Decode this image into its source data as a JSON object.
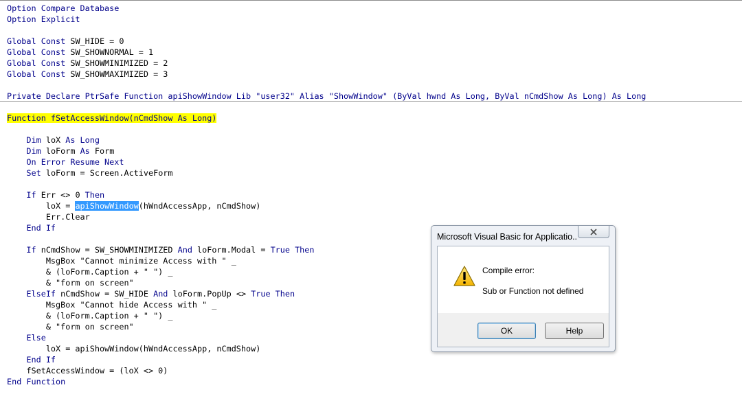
{
  "code": {
    "lines": [
      [
        {
          "t": "Option Compare Database",
          "c": "kw"
        }
      ],
      [
        {
          "t": "Option Explicit",
          "c": "kw"
        }
      ],
      [],
      [
        {
          "t": "Global Const",
          "c": "kw"
        },
        {
          "t": " SW_HIDE = 0"
        }
      ],
      [
        {
          "t": "Global Const",
          "c": "kw"
        },
        {
          "t": " SW_SHOWNORMAL = 1"
        }
      ],
      [
        {
          "t": "Global Const",
          "c": "kw"
        },
        {
          "t": " SW_SHOWMINIMIZED = 2"
        }
      ],
      [
        {
          "t": "Global Const",
          "c": "kw"
        },
        {
          "t": " SW_SHOWMAXIMIZED = 3"
        }
      ],
      [],
      [
        {
          "t": "Private Declare PtrSafe Function apiShowWindow Lib \"user32\" Alias \"ShowWindow\" (ByVal hwnd As Long, ByVal nCmdShow As Long) As Long",
          "c": "kw"
        }
      ],
      [],
      [
        {
          "t": "Function fSetAccessWindow(nCmdShow As Long)",
          "c": "kw hl-yellow"
        }
      ],
      [],
      [
        {
          "t": "    "
        },
        {
          "t": "Dim",
          "c": "kw"
        },
        {
          "t": " loX "
        },
        {
          "t": "As Long",
          "c": "kw"
        }
      ],
      [
        {
          "t": "    "
        },
        {
          "t": "Dim",
          "c": "kw"
        },
        {
          "t": " loForm "
        },
        {
          "t": "As",
          "c": "kw"
        },
        {
          "t": " Form"
        }
      ],
      [
        {
          "t": "    "
        },
        {
          "t": "On Error Resume Next",
          "c": "kw"
        }
      ],
      [
        {
          "t": "    "
        },
        {
          "t": "Set",
          "c": "kw"
        },
        {
          "t": " loForm = Screen.ActiveForm"
        }
      ],
      [],
      [
        {
          "t": "    "
        },
        {
          "t": "If",
          "c": "kw"
        },
        {
          "t": " Err <> 0 "
        },
        {
          "t": "Then",
          "c": "kw"
        }
      ],
      [
        {
          "t": "        loX = "
        },
        {
          "t": "apiShowWindow",
          "c": "hl-blue"
        },
        {
          "t": "(hWndAccessApp, nCmdShow)"
        }
      ],
      [
        {
          "t": "        Err.Clear"
        }
      ],
      [
        {
          "t": "    "
        },
        {
          "t": "End If",
          "c": "kw"
        }
      ],
      [],
      [
        {
          "t": "    "
        },
        {
          "t": "If",
          "c": "kw"
        },
        {
          "t": " nCmdShow = SW_SHOWMINIMIZED "
        },
        {
          "t": "And",
          "c": "kw"
        },
        {
          "t": " loForm.Modal = "
        },
        {
          "t": "True Then",
          "c": "kw"
        }
      ],
      [
        {
          "t": "        MsgBox \"Cannot minimize Access with \" _"
        }
      ],
      [
        {
          "t": "        & (loForm.Caption + \" \") _"
        }
      ],
      [
        {
          "t": "        & \"form on screen\""
        }
      ],
      [
        {
          "t": "    "
        },
        {
          "t": "ElseIf",
          "c": "kw"
        },
        {
          "t": " nCmdShow = SW_HIDE "
        },
        {
          "t": "And",
          "c": "kw"
        },
        {
          "t": " loForm.PopUp <> "
        },
        {
          "t": "True Then",
          "c": "kw"
        }
      ],
      [
        {
          "t": "        MsgBox \"Cannot hide Access with \" _"
        }
      ],
      [
        {
          "t": "        & (loForm.Caption + \" \") _"
        }
      ],
      [
        {
          "t": "        & \"form on screen\""
        }
      ],
      [
        {
          "t": "    "
        },
        {
          "t": "Else",
          "c": "kw"
        }
      ],
      [
        {
          "t": "        loX = apiShowWindow(hWndAccessApp, nCmdShow)"
        }
      ],
      [
        {
          "t": "    "
        },
        {
          "t": "End If",
          "c": "kw"
        }
      ],
      [
        {
          "t": "    fSetAccessWindow = (loX <> 0)"
        }
      ],
      [
        {
          "t": "End Function",
          "c": "kw"
        }
      ]
    ]
  },
  "dialog": {
    "title": "Microsoft Visual Basic for Applicatio...",
    "close_icon": "close-x-icon",
    "message_icon": "warning-icon",
    "message_heading": "Compile error:",
    "message_detail": "Sub or Function not defined",
    "ok_label": "OK",
    "help_label": "Help"
  },
  "colors": {
    "keyword": "#00008b",
    "line_highlight": "#ffff00",
    "selection": "#3399ff",
    "dialog_frame": "#eef1f6"
  }
}
